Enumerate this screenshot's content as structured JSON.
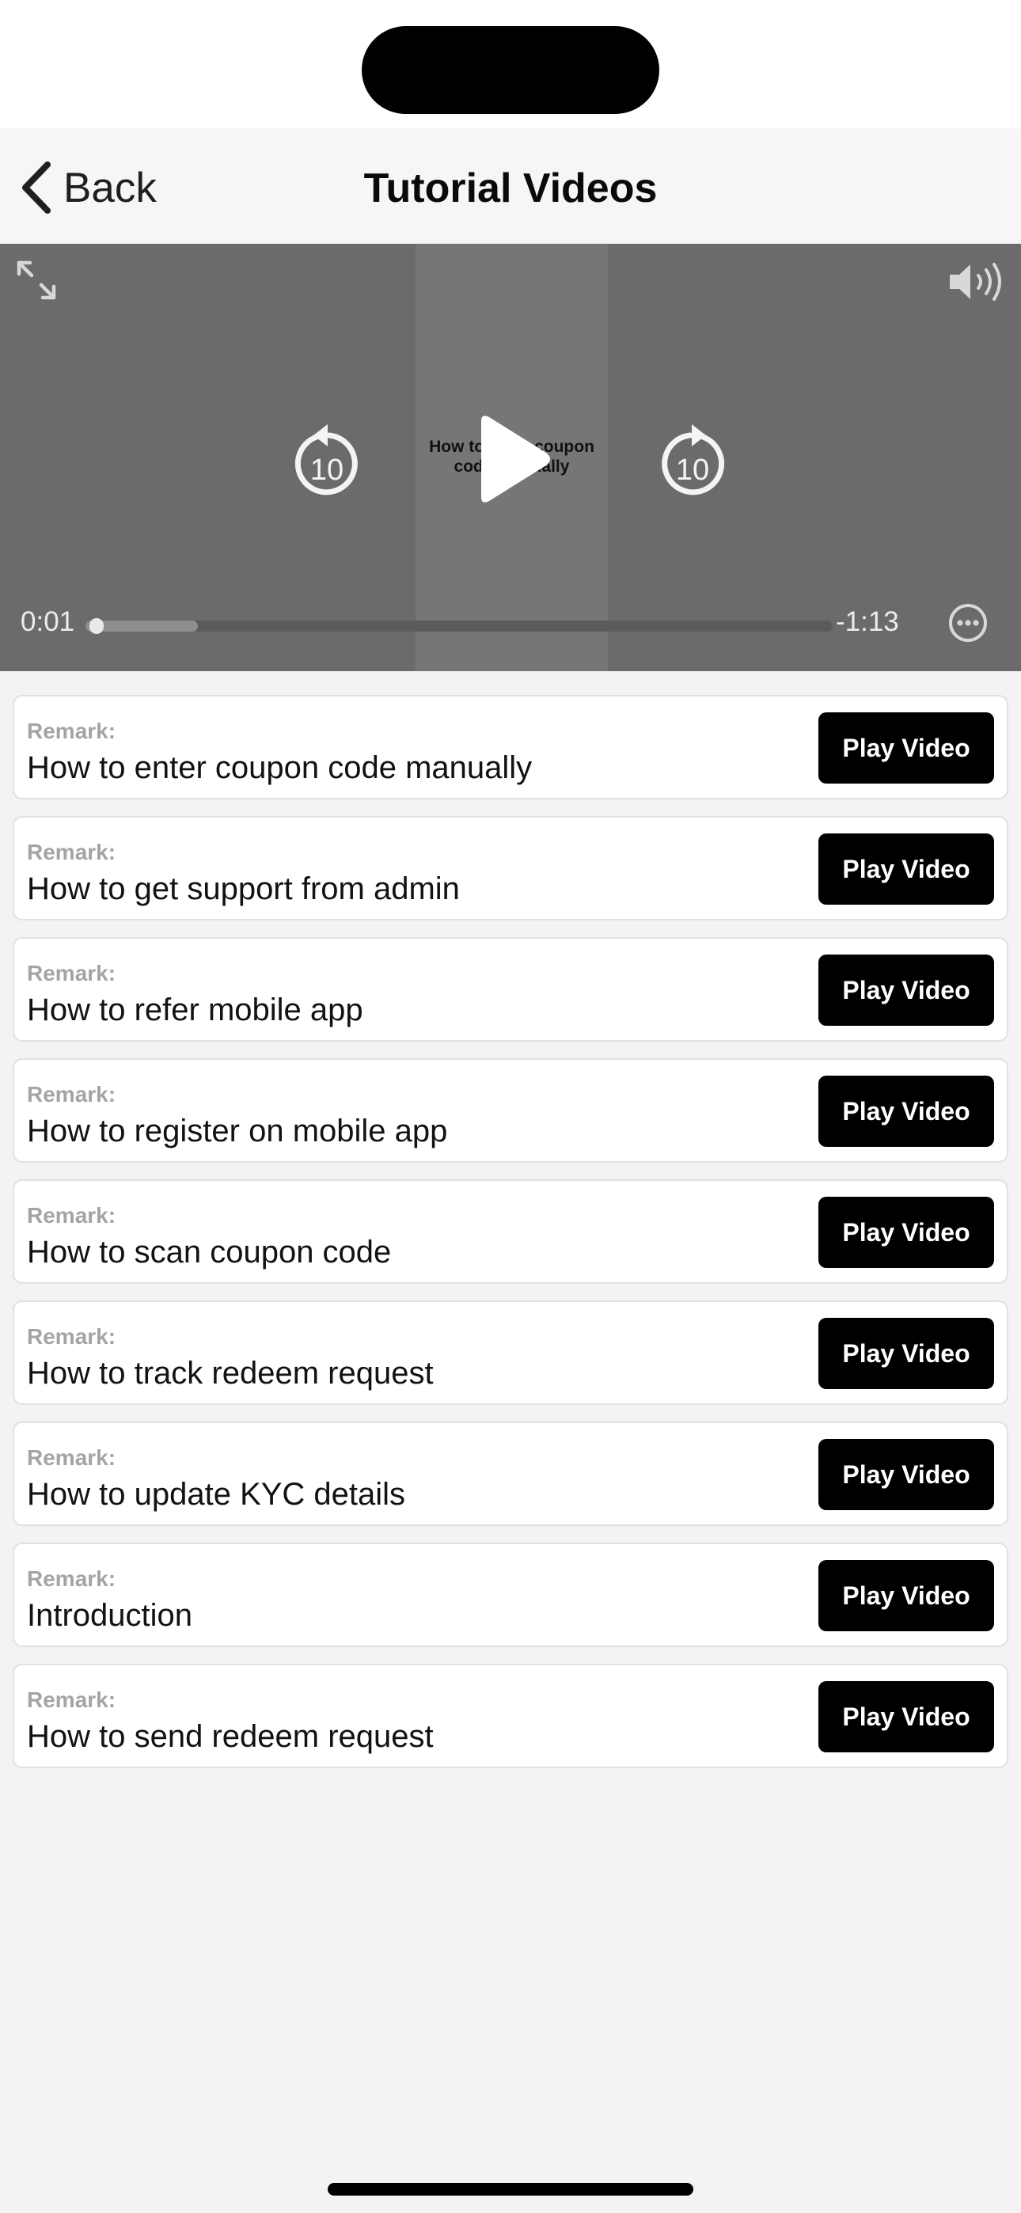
{
  "nav": {
    "back_label": "Back",
    "title": "Tutorial Videos"
  },
  "player": {
    "caption": "How to enter coupon code manually",
    "time_elapsed": "0:01",
    "time_remaining": "-1:13",
    "progress": 0.01,
    "buffered": 0.15,
    "skip_seconds": "10",
    "icons": {
      "fullscreen": "expand-arrows-icon",
      "volume": "speaker-wave-icon",
      "rewind": "rewind-10-icon",
      "play": "play-icon",
      "forward": "forward-10-icon",
      "more": "ellipsis-circle-icon"
    }
  },
  "list": {
    "remark_label": "Remark:",
    "button_label": "Play Video",
    "items": [
      {
        "title": "How to enter coupon code manually"
      },
      {
        "title": "How to get support from admin"
      },
      {
        "title": "How to refer mobile app"
      },
      {
        "title": "How to register on mobile app"
      },
      {
        "title": "How to scan coupon code"
      },
      {
        "title": "How to track redeem request"
      },
      {
        "title": "How to update KYC details"
      },
      {
        "title": "Introduction"
      },
      {
        "title": "How to send redeem request"
      }
    ]
  },
  "colors": {
    "accent": "#000000",
    "background": "#f3f3f3",
    "player": "#6b6b6b",
    "remark": "#a4a4a4"
  }
}
